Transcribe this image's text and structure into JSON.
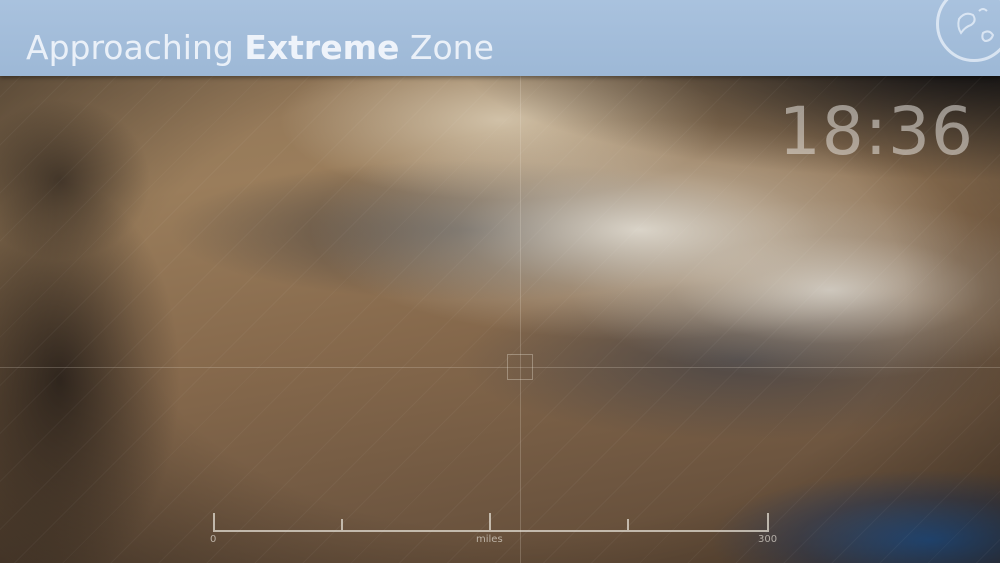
{
  "header": {
    "title_prefix": "Approaching",
    "title_emphasis": "Extreme",
    "title_suffix": "Zone",
    "logo_icon": "globe-icon"
  },
  "hud": {
    "clock": "18:36"
  },
  "scale_bar": {
    "start_label": "0",
    "unit_label": "miles",
    "end_label": "300"
  },
  "colors": {
    "header_bg": "#a9c2de",
    "header_text": "#eef3fa",
    "hud_text": "#e6e2dc"
  }
}
